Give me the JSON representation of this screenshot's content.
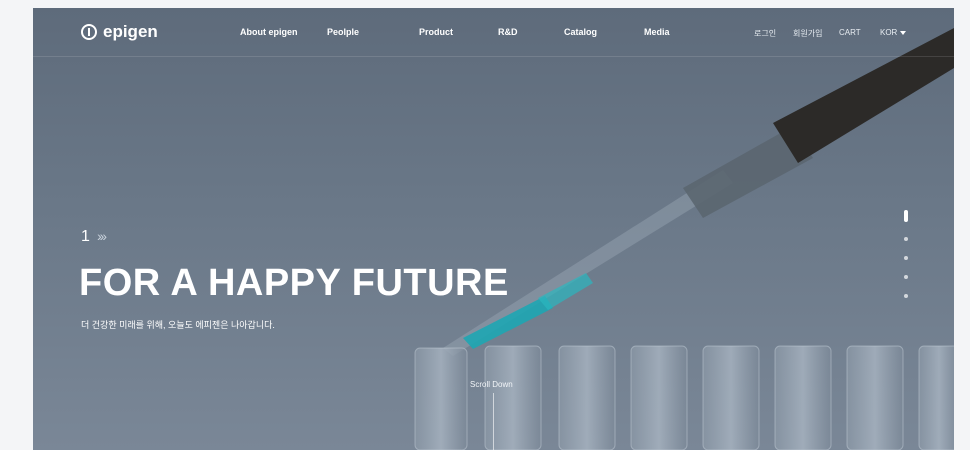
{
  "brand": {
    "name": "epigen"
  },
  "nav": [
    "About epigen",
    "Peolple",
    "Product",
    "R&D",
    "Catalog",
    "Media"
  ],
  "utility": {
    "login": "로그인",
    "signup": "회원가입",
    "cart": "CART",
    "lang": "KOR"
  },
  "hero": {
    "slide_number": "1",
    "chevrons": "›››",
    "title": "FOR A HAPPY FUTURE",
    "subtitle": "더 건강한 미래를 위해, 오늘도 에피젠은 나아갑니다.",
    "scroll_label": "Scroll Down"
  },
  "pagination": {
    "active": 1,
    "total": 5
  }
}
